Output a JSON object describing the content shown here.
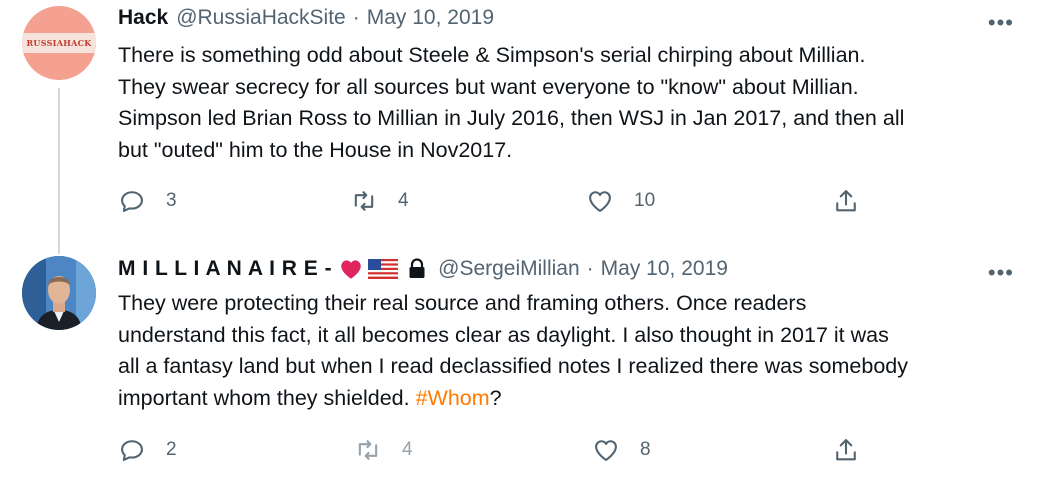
{
  "tweets": [
    {
      "display_name": "Hack",
      "handle": "@RussiaHackSite",
      "separator": "·",
      "date": "May 10, 2019",
      "avatar_text": "RUSSIAHACK",
      "text_lines": [
        "There is something odd about Steele & Simpson's serial chirping about Millian.",
        "They swear secrecy for all sources but want everyone to \"know\" about Millian.",
        "Simpson led Brian Ross to Millian in July 2016, then WSJ in Jan 2017, and then all",
        "but \"outed\" him to the House in Nov2017."
      ],
      "more_label": "•••",
      "actions": {
        "replies": "3",
        "retweets": "4",
        "likes": "10"
      }
    },
    {
      "display_name": "M I L L I A N A I R E -",
      "handle": "@SergeiMillian",
      "separator": "·",
      "date": "May 10, 2019",
      "text_lines": [
        "They were protecting their real source and framing others. Once readers",
        "understand this fact, it all becomes clear as daylight. I also thought in 2017 it was",
        "all a fantasy land but when I read declassified notes I realized there was somebody"
      ],
      "last_line_prefix": "important whom they shielded. ",
      "hashtag": "#Whom",
      "last_line_suffix": "?",
      "more_label": "•••",
      "actions": {
        "replies": "2",
        "retweets": "4",
        "likes": "8"
      }
    }
  ],
  "colors": {
    "hashtag": "#ff7a00",
    "muted": "#536471",
    "heart": "#e0245e",
    "thread_line": "#cfd9de"
  },
  "icons": [
    "reply-icon",
    "retweet-icon",
    "like-icon",
    "share-icon",
    "more-icon",
    "heart-emoji-icon",
    "us-flag-icon",
    "lock-icon"
  ]
}
